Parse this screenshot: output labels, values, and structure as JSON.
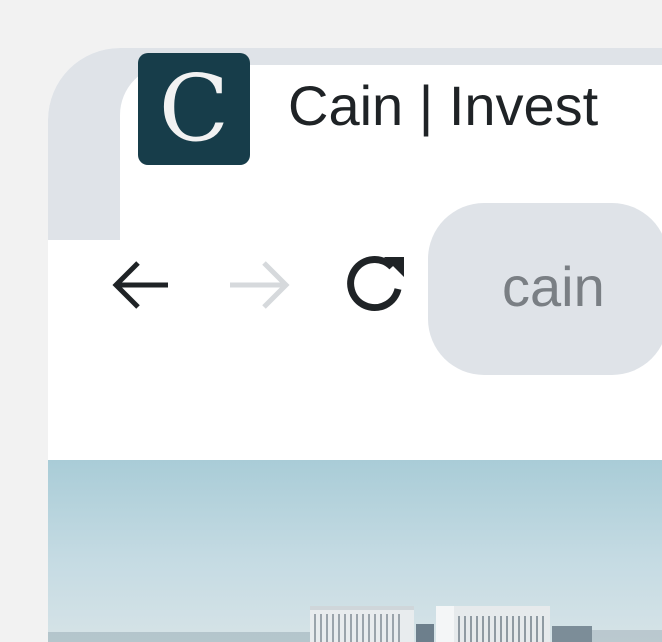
{
  "tab": {
    "favicon_letter": "C",
    "title": "Cain | Invest"
  },
  "toolbar": {
    "back_icon": "arrow-left-icon",
    "forward_icon": "arrow-right-icon",
    "reload_icon": "reload-icon",
    "url": "cain"
  },
  "colors": {
    "page_bg": "#f2f2f2",
    "tabstrip_bg": "#dfe3e8",
    "favicon_bg": "#173d4a",
    "text_primary": "#1f2326",
    "text_muted": "#7a7f84",
    "disabled_icon": "#d6d9dc"
  }
}
